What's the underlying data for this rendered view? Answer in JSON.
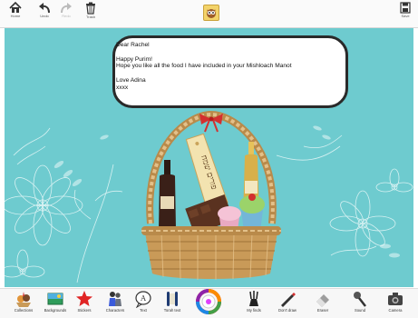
{
  "toolbar": {
    "home": "Home",
    "undo": "Undo",
    "redo": "Redo",
    "trash": "Trash",
    "save": "Save"
  },
  "message": {
    "greeting": "Dear Rachel",
    "line1": "Happy Purim!",
    "line2": "Hope you like all the food I have included in your Mishloach Manot",
    "closing": "Love Adina",
    "kisses": "xxxx"
  },
  "tag": {
    "text": "פורים שמח"
  },
  "bottom_tools": [
    {
      "label": "Collections",
      "icon": "collections-icon"
    },
    {
      "label": "Backgrounds",
      "icon": "backgrounds-icon"
    },
    {
      "label": "Stickers",
      "icon": "star-icon"
    },
    {
      "label": "Characters",
      "icon": "characters-icon"
    },
    {
      "label": "Text",
      "icon": "text-icon"
    },
    {
      "label": "Torah text",
      "icon": "torah-text-icon"
    },
    {
      "label": "",
      "icon": "color-wheel-icon"
    },
    {
      "label": "My finds",
      "icon": "my-finds-icon"
    },
    {
      "label": "Don't draw",
      "icon": "pen-icon"
    },
    {
      "label": "Eraser",
      "icon": "eraser-icon"
    },
    {
      "label": "Sound",
      "icon": "microphone-icon"
    },
    {
      "label": "Camera",
      "icon": "camera-icon"
    }
  ],
  "colors": {
    "canvas_bg": "#6ecbcf",
    "bubble_border": "#2a2a2a"
  }
}
